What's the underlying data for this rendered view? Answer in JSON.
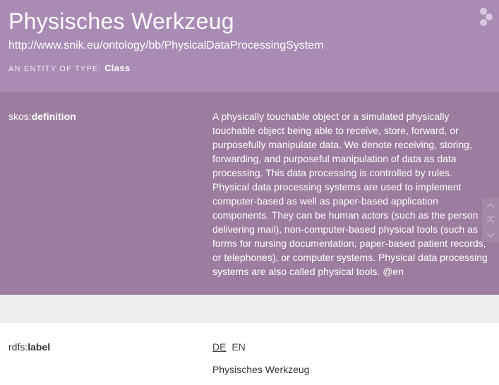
{
  "header": {
    "title": "Physisches Werkzeug",
    "uri": "http://www.snik.eu/ontology/bb/PhysicalDataProcessingSystem",
    "type_prefix": "An entity of type:",
    "type_value": "Class",
    "logo_icon": "lodview-logo-icon"
  },
  "definition": {
    "predicate_prefix": "skos:",
    "predicate_name": "definition",
    "text": "A physically touchable object or a simulated physically touchable object being able to receive, store, forward, or purposefully manipulate data. We denote receiving, storing, forwarding, and purposeful manipulation of data as data processing. This data processing is controlled by rules. Physical data processing systems are used to implement computer-based as well as paper-based application components. They can be human actors (such as the person delivering mail), non-computer-based physical tools (such as forms for nursing documentation, paper-based patient records, or telephones), or computer systems. Physical data processing systems are also called physical tools.",
    "lang": "@en"
  },
  "label": {
    "predicate_prefix": "rdfs:",
    "predicate_name": "label",
    "lang_tabs": [
      "DE",
      "EN"
    ],
    "active_lang": "DE",
    "value": "Physisches Werkzeug"
  },
  "scroll_controls": {
    "up_icon": "chevron-up-icon",
    "top_icon": "scroll-to-top-icon",
    "down_icon": "chevron-down-icon"
  },
  "colors": {
    "header_bg": "#a98bb4",
    "definition_bg": "#9c7d9f",
    "gap_bg": "#eeeeee"
  }
}
